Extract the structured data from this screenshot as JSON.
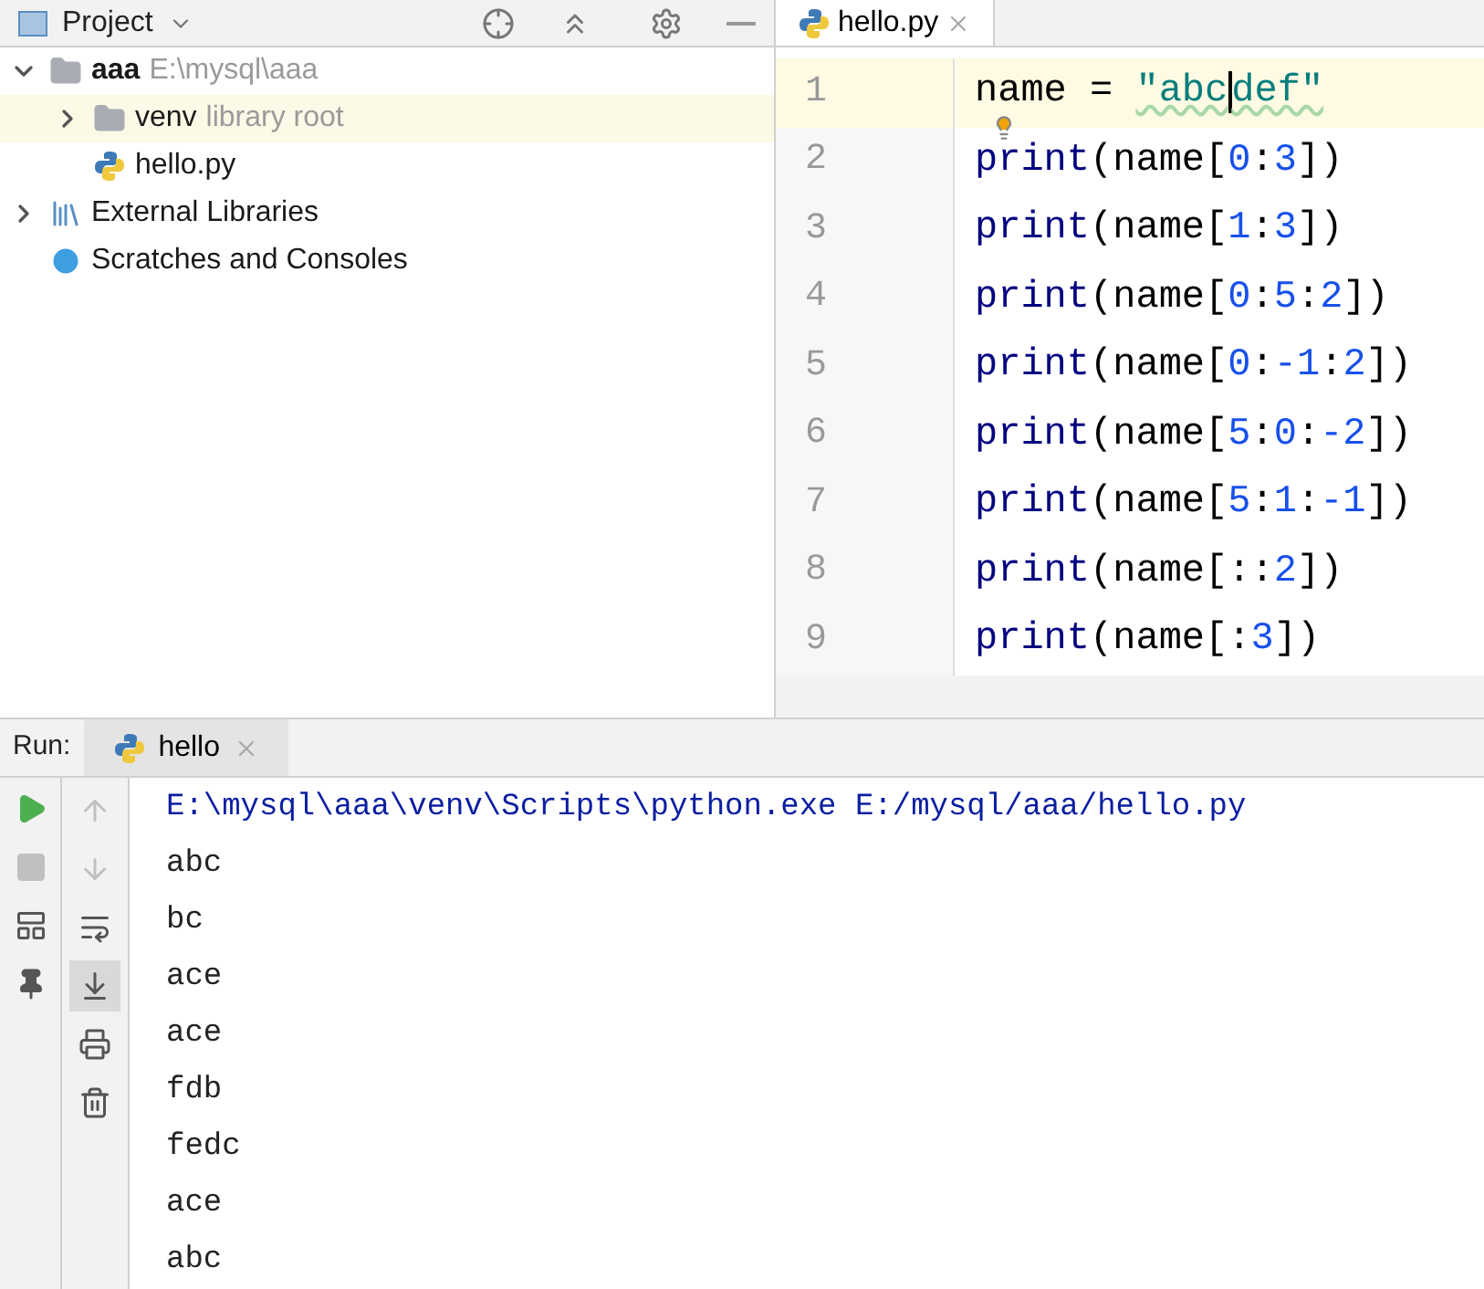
{
  "project_panel": {
    "title": "Project",
    "tree": [
      {
        "label": "aaa",
        "hint": "E:\\mysql\\aaa",
        "kind": "folder",
        "expanded": true,
        "highlighted": false,
        "children": [
          {
            "label": "venv",
            "hint": "library root",
            "kind": "folder",
            "expanded": false,
            "highlighted": true
          },
          {
            "label": "hello.py",
            "kind": "python-file",
            "highlighted": false
          }
        ]
      },
      {
        "label": "External Libraries",
        "kind": "libraries",
        "expanded": false,
        "highlighted": false
      },
      {
        "label": "Scratches and Consoles",
        "kind": "scratches",
        "highlighted": false
      }
    ]
  },
  "editor": {
    "tab": {
      "label": "hello.py",
      "selected": true
    },
    "lines": [
      {
        "number": "1",
        "current": true,
        "bulb": false,
        "tokens": [
          {
            "text": "name = ",
            "kind": "plain"
          },
          {
            "text": "\"abc",
            "kind": "string",
            "warning": true
          },
          {
            "text": "def\"",
            "kind": "string",
            "warning": true,
            "caret_before": true
          }
        ]
      },
      {
        "number": "2",
        "current": false,
        "bulb": true,
        "tokens": [
          {
            "text": "print",
            "kind": "builtin"
          },
          {
            "text": "(name[",
            "kind": "plain"
          },
          {
            "text": "0",
            "kind": "number"
          },
          {
            "text": ":",
            "kind": "plain"
          },
          {
            "text": "3",
            "kind": "number"
          },
          {
            "text": "])",
            "kind": "plain"
          }
        ]
      },
      {
        "number": "3",
        "current": false,
        "bulb": false,
        "tokens": [
          {
            "text": "print",
            "kind": "builtin"
          },
          {
            "text": "(name[",
            "kind": "plain"
          },
          {
            "text": "1",
            "kind": "number"
          },
          {
            "text": ":",
            "kind": "plain"
          },
          {
            "text": "3",
            "kind": "number"
          },
          {
            "text": "])",
            "kind": "plain"
          }
        ]
      },
      {
        "number": "4",
        "current": false,
        "bulb": false,
        "tokens": [
          {
            "text": "print",
            "kind": "builtin"
          },
          {
            "text": "(name[",
            "kind": "plain"
          },
          {
            "text": "0",
            "kind": "number"
          },
          {
            "text": ":",
            "kind": "plain"
          },
          {
            "text": "5",
            "kind": "number"
          },
          {
            "text": ":",
            "kind": "plain"
          },
          {
            "text": "2",
            "kind": "number"
          },
          {
            "text": "])",
            "kind": "plain"
          }
        ]
      },
      {
        "number": "5",
        "current": false,
        "bulb": false,
        "tokens": [
          {
            "text": "print",
            "kind": "builtin"
          },
          {
            "text": "(name[",
            "kind": "plain"
          },
          {
            "text": "0",
            "kind": "number"
          },
          {
            "text": ":",
            "kind": "plain"
          },
          {
            "text": "-1",
            "kind": "number"
          },
          {
            "text": ":",
            "kind": "plain"
          },
          {
            "text": "2",
            "kind": "number"
          },
          {
            "text": "])",
            "kind": "plain"
          }
        ]
      },
      {
        "number": "6",
        "current": false,
        "bulb": false,
        "tokens": [
          {
            "text": "print",
            "kind": "builtin"
          },
          {
            "text": "(name[",
            "kind": "plain"
          },
          {
            "text": "5",
            "kind": "number"
          },
          {
            "text": ":",
            "kind": "plain"
          },
          {
            "text": "0",
            "kind": "number"
          },
          {
            "text": ":",
            "kind": "plain"
          },
          {
            "text": "-2",
            "kind": "number"
          },
          {
            "text": "])",
            "kind": "plain"
          }
        ]
      },
      {
        "number": "7",
        "current": false,
        "bulb": false,
        "tokens": [
          {
            "text": "print",
            "kind": "builtin"
          },
          {
            "text": "(name[",
            "kind": "plain"
          },
          {
            "text": "5",
            "kind": "number"
          },
          {
            "text": ":",
            "kind": "plain"
          },
          {
            "text": "1",
            "kind": "number"
          },
          {
            "text": ":",
            "kind": "plain"
          },
          {
            "text": "-1",
            "kind": "number"
          },
          {
            "text": "])",
            "kind": "plain"
          }
        ]
      },
      {
        "number": "8",
        "current": false,
        "bulb": false,
        "tokens": [
          {
            "text": "print",
            "kind": "builtin"
          },
          {
            "text": "(name[::",
            "kind": "plain"
          },
          {
            "text": "2",
            "kind": "number"
          },
          {
            "text": "])",
            "kind": "plain"
          }
        ]
      },
      {
        "number": "9",
        "current": false,
        "bulb": false,
        "tokens": [
          {
            "text": "print",
            "kind": "builtin"
          },
          {
            "text": "(name[:",
            "kind": "plain"
          },
          {
            "text": "3",
            "kind": "number"
          },
          {
            "text": "])",
            "kind": "plain"
          }
        ]
      }
    ]
  },
  "run_panel": {
    "label": "Run:",
    "tab": {
      "label": "hello",
      "selected": true
    },
    "left_tools": [
      {
        "kind": "run",
        "disabled": false
      },
      {
        "kind": "stop",
        "disabled": true
      },
      {
        "kind": "layout",
        "disabled": false
      },
      {
        "kind": "pin",
        "disabled": false
      }
    ],
    "tools": [
      {
        "kind": "up",
        "disabled": true,
        "on": false
      },
      {
        "kind": "down",
        "disabled": true,
        "on": false
      },
      {
        "kind": "wrap",
        "disabled": false,
        "on": false
      },
      {
        "kind": "scroll-end",
        "disabled": false,
        "on": true
      },
      {
        "kind": "print",
        "disabled": false,
        "on": false
      },
      {
        "kind": "delete",
        "disabled": false,
        "on": false
      }
    ],
    "output": [
      {
        "text": "E:\\mysql\\aaa\\venv\\Scripts\\python.exe E:/mysql/aaa/hello.py",
        "kind": "command"
      },
      {
        "text": "abc",
        "kind": "stdout"
      },
      {
        "text": "bc",
        "kind": "stdout"
      },
      {
        "text": "ace",
        "kind": "stdout"
      },
      {
        "text": "ace",
        "kind": "stdout"
      },
      {
        "text": "fdb",
        "kind": "stdout"
      },
      {
        "text": "fedc",
        "kind": "stdout"
      },
      {
        "text": "ace",
        "kind": "stdout"
      },
      {
        "text": "abc",
        "kind": "stdout"
      }
    ]
  }
}
